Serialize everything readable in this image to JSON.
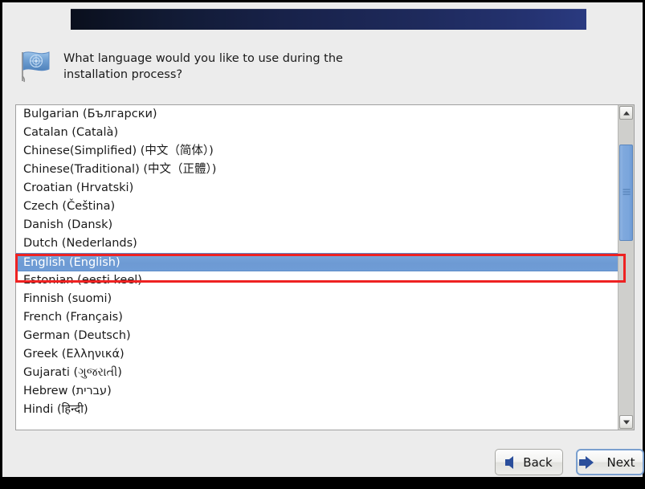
{
  "window": {
    "progress_bar_name": "installer-progress-bar"
  },
  "prompt": {
    "icon": "flag-icon",
    "text": "What language would you like to use during the\ninstallation process?"
  },
  "language_list": {
    "selected": "English (English)",
    "items": [
      "Bulgarian (Български)",
      "Catalan (Català)",
      "Chinese(Simplified) (中文（简体）)",
      "Chinese(Traditional) (中文（正體）)",
      "Croatian (Hrvatski)",
      "Czech (Čeština)",
      "Danish (Dansk)",
      "Dutch (Nederlands)",
      "English (English)",
      "Estonian (eesti keel)",
      "Finnish (suomi)",
      "French (Français)",
      "German (Deutsch)",
      "Greek (Ελληνικά)",
      "Gujarati (ગુજરાતી)",
      "Hebrew (עברית)",
      "Hindi (हिन्दी)"
    ]
  },
  "scrollbar": {
    "up_arrow": "scroll-up-arrow",
    "down_arrow": "scroll-down-arrow",
    "thumb": "scroll-thumb"
  },
  "buttons": {
    "back_label": "Back",
    "next_label": "Next"
  },
  "colors": {
    "selection_blue": "#6f9cd6",
    "annotation_red": "#ee2222",
    "title_bar_blue": "#1e2a5c",
    "arrow_blue": "#2a4e9b"
  }
}
